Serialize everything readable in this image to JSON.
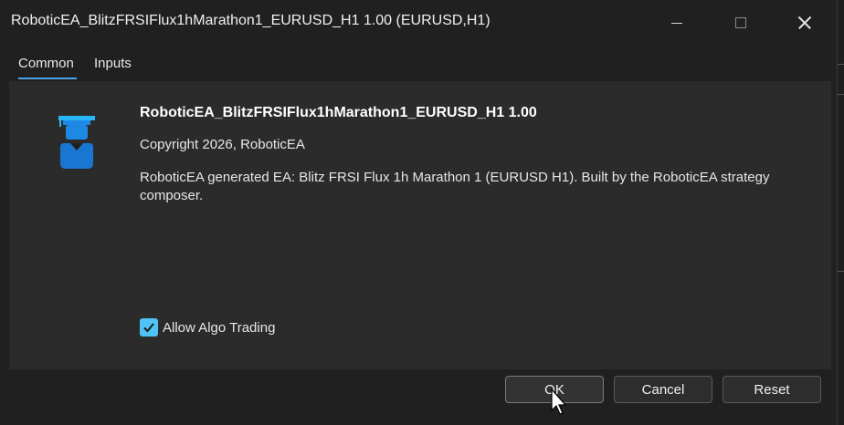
{
  "window": {
    "title": "RoboticEA_BlitzFRSIFlux1hMarathon1_EURUSD_H1 1.00 (EURUSD,H1)"
  },
  "tabs": [
    {
      "label": "Common",
      "active": true
    },
    {
      "label": "Inputs",
      "active": false
    }
  ],
  "expert": {
    "icon": "expert-advisor-icon",
    "name": "RoboticEA_BlitzFRSIFlux1hMarathon1_EURUSD_H1 1.00",
    "copyright": "Copyright 2026, RoboticEA",
    "description": "RoboticEA generated EA: Blitz FRSI Flux 1h Marathon 1 (EURUSD H1). Built by the RoboticEA strategy composer."
  },
  "options": {
    "allow_algo_trading_label": "Allow Algo Trading",
    "allow_algo_trading_checked": true
  },
  "buttons": {
    "ok_label": "OK",
    "cancel_label": "Cancel",
    "reset_label": "Reset"
  },
  "colors": {
    "accent": "#4ba3e3",
    "checkbox": "#4fc3f7",
    "icon_blue": "#1e88e5"
  }
}
